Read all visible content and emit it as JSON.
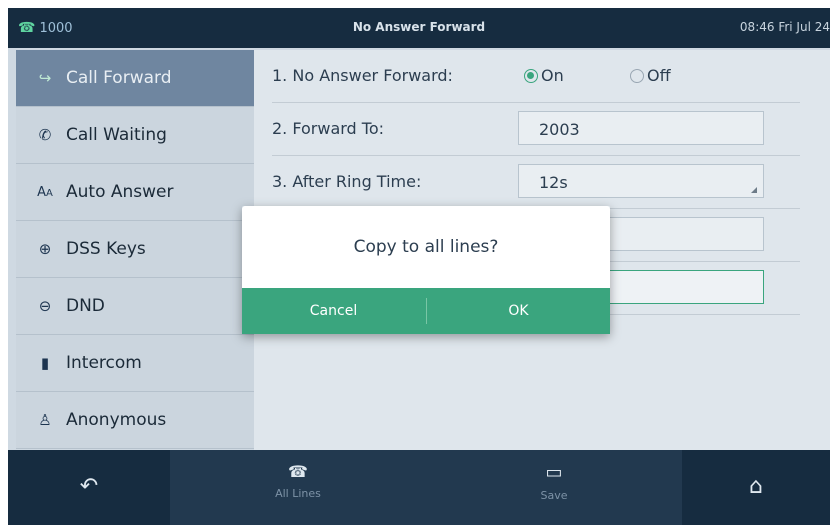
{
  "status_bar": {
    "line": "1000",
    "title": "No Answer Forward",
    "datetime": "08:46 Fri Jul 24",
    "line_icon": "phone-handset-icon"
  },
  "sidebar": {
    "items": [
      {
        "label": "Call Forward",
        "icon": "call-forward-icon",
        "active": true
      },
      {
        "label": "Call Waiting",
        "icon": "call-waiting-icon",
        "active": false
      },
      {
        "label": "Auto Answer",
        "icon": "auto-answer-icon",
        "active": false
      },
      {
        "label": "DSS Keys",
        "icon": "dss-keys-icon",
        "active": false
      },
      {
        "label": "DND",
        "icon": "dnd-icon",
        "active": false
      },
      {
        "label": "Intercom",
        "icon": "intercom-icon",
        "active": false
      },
      {
        "label": "Anonymous",
        "icon": "anonymous-icon",
        "active": false
      }
    ]
  },
  "settings": {
    "no_answer_forward_label": "1. No Answer Forward:",
    "on_label": "On",
    "off_label": "Off",
    "selected": "On",
    "forward_to_label": "2. Forward To:",
    "forward_to_value": "2003",
    "after_ring_time_label": "3. After Ring Time:",
    "after_ring_time_value": "12s"
  },
  "dialog": {
    "message": "Copy to all lines?",
    "cancel_label": "Cancel",
    "ok_label": "OK"
  },
  "softkeys": {
    "back_icon": "back-arrow-icon",
    "all_lines_label": "All Lines",
    "all_lines_icon": "phone-icon",
    "save_label": "Save",
    "save_icon": "save-icon",
    "home_icon": "home-icon"
  },
  "colors": {
    "accent": "#3aa57e",
    "bar": "#162c40",
    "sidebar_active": "#6f86a0"
  }
}
